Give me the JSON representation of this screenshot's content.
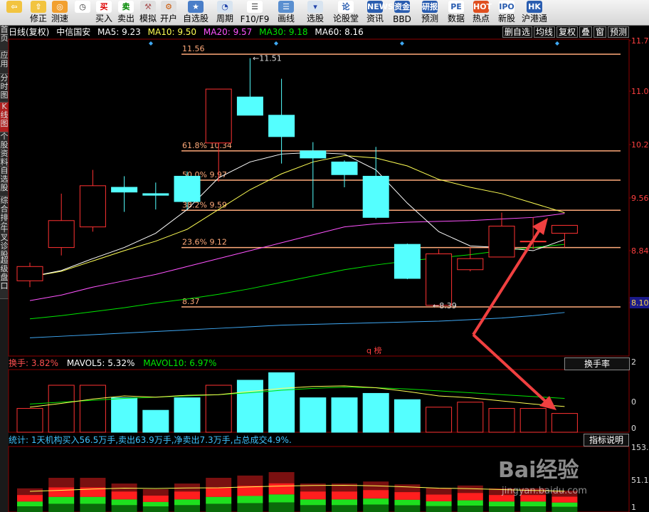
{
  "toolbar": {
    "buttons": [
      {
        "label": "",
        "icon": "back-arrow-icon",
        "glyph": "⇦",
        "bg": "#f2c440",
        "color": "#fff"
      },
      {
        "label": "修正",
        "icon": "up-down-icon",
        "glyph": "⇧",
        "bg": "#f2c440",
        "color": "#fff"
      },
      {
        "label": "测速",
        "icon": "speed-icon",
        "glyph": "◎",
        "bg": "#f2a030",
        "color": "#fff"
      },
      {
        "label": "",
        "icon": "clock-icon",
        "glyph": "◷",
        "bg": "#ffffff",
        "color": "#333"
      },
      {
        "label": "买入",
        "icon": "buy-icon",
        "glyph": "买",
        "bg": "#ffffff",
        "color": "#d00"
      },
      {
        "label": "卖出",
        "icon": "sell-icon",
        "glyph": "卖",
        "bg": "#ffffff",
        "color": "#080"
      },
      {
        "label": "模拟",
        "icon": "hammer-icon",
        "glyph": "⚒",
        "bg": "#e0e0e0",
        "color": "#a55"
      },
      {
        "label": "开户",
        "icon": "open-account-icon",
        "glyph": "⚙",
        "bg": "#e0e0e0",
        "color": "#c50"
      },
      {
        "label": "自选股",
        "icon": "star-icon",
        "glyph": "★",
        "bg": "#4a7ec8",
        "color": "#fff"
      },
      {
        "label": "周期",
        "icon": "cycle-icon",
        "glyph": "◔",
        "bg": "#d8e4f0",
        "color": "#24a"
      },
      {
        "label": "F10/F9",
        "icon": "f10-icon",
        "glyph": "☰",
        "bg": "#ffffff",
        "color": "#333"
      },
      {
        "label": "画线",
        "icon": "draw-line-icon",
        "glyph": "☰",
        "bg": "#5a8fd0",
        "color": "#fff"
      },
      {
        "label": "选股",
        "icon": "select-stock-icon",
        "glyph": "▾",
        "bg": "#d8e4f0",
        "color": "#24a"
      },
      {
        "label": "论股堂",
        "icon": "forum-icon",
        "glyph": "论",
        "bg": "#ffffff",
        "color": "#2a5db0"
      },
      {
        "label": "资讯",
        "icon": "news-icon",
        "glyph": "NEWS",
        "bg": "#2a5db0",
        "color": "#fff"
      },
      {
        "label": "BBD",
        "icon": "bbd-icon",
        "glyph": "资金",
        "bg": "#2a5db0",
        "color": "#fff"
      },
      {
        "label": "预测",
        "icon": "forecast-icon",
        "glyph": "研报",
        "bg": "#2a5db0",
        "color": "#fff"
      },
      {
        "label": "数据",
        "icon": "pe-icon",
        "glyph": "PE",
        "bg": "#ffffff",
        "color": "#2a5db0"
      },
      {
        "label": "热点",
        "icon": "hot-icon",
        "glyph": "HOT",
        "bg": "#e05020",
        "color": "#fff"
      },
      {
        "label": "新股",
        "icon": "ipo-icon",
        "glyph": "IPO",
        "bg": "#ffffff",
        "color": "#2a5db0"
      },
      {
        "label": "沪港通",
        "icon": "hkex-icon",
        "glyph": "HK",
        "bg": "#2a5db0",
        "color": "#fff"
      }
    ]
  },
  "leftbar": [
    "首页",
    "应用",
    "分时图",
    "K线图",
    "个股资料",
    "自选股",
    "综合排名",
    "牛叉诊股",
    "超级盘口"
  ],
  "header": {
    "chart_type": "日线(复权)",
    "stock": "中信国安",
    "ma5": "MA5: 9.23",
    "ma10": "MA10: 9.50",
    "ma20": "MA20: 9.57",
    "ma30": "MA30: 9.18",
    "ma60": "MA60: 8.16",
    "buttons": [
      "删自选",
      "均线",
      "复权",
      "叠",
      "窗",
      "预测"
    ]
  },
  "colors": {
    "up": "#ff3232",
    "down": "#54ffff",
    "ma5": "#ffffff",
    "ma10": "#ffff54",
    "ma20": "#ff54ff",
    "ma30": "#00e600",
    "ma60": "#3fa9f5",
    "fib": "#ffaa7a",
    "arrow": "#f04040"
  },
  "chart_data": {
    "type": "candlestick",
    "ylim": [
      7.75,
      11.75
    ],
    "y_ticks": [
      "11.7",
      "11.0",
      "10.2",
      "9.56",
      "8.84",
      "8.10"
    ],
    "current_price": "8.10",
    "candles": [
      {
        "o": 8.7,
        "c": 8.88,
        "h": 8.93,
        "l": 8.62
      },
      {
        "o": 9.12,
        "c": 9.46,
        "h": 9.8,
        "l": 9.02
      },
      {
        "o": 9.38,
        "c": 9.9,
        "h": 10.1,
        "l": 9.32
      },
      {
        "o": 9.88,
        "c": 9.82,
        "h": 10.02,
        "l": 9.57
      },
      {
        "o": 9.8,
        "c": 9.78,
        "h": 9.94,
        "l": 9.6
      },
      {
        "o": 10.02,
        "c": 9.7,
        "h": 10.08,
        "l": 9.6
      },
      {
        "o": 10.44,
        "c": 11.12,
        "h": 11.12,
        "l": 9.95
      },
      {
        "o": 11.02,
        "c": 10.79,
        "h": 11.51,
        "l": 10.79
      },
      {
        "o": 10.79,
        "c": 10.52,
        "h": 11.25,
        "l": 10.18
      },
      {
        "o": 10.34,
        "c": 10.25,
        "h": 10.45,
        "l": 9.62
      },
      {
        "o": 10.2,
        "c": 10.04,
        "h": 10.22,
        "l": 9.88
      },
      {
        "o": 10.02,
        "c": 9.5,
        "h": 10.39,
        "l": 9.48
      },
      {
        "o": 9.16,
        "c": 8.73,
        "h": 9.17,
        "l": 8.72
      },
      {
        "o": 8.39,
        "c": 9.04,
        "h": 9.1,
        "l": 8.39
      },
      {
        "o": 8.84,
        "c": 8.98,
        "h": 9.12,
        "l": 8.82
      },
      {
        "o": 9.0,
        "c": 9.39,
        "h": 9.56,
        "l": 9.0
      },
      {
        "o": 9.2,
        "c": 9.2,
        "h": 9.5,
        "l": 9.1
      },
      {
        "o": 9.3,
        "c": 9.4,
        "h": 9.4,
        "l": 9.12
      }
    ],
    "ma5": [
      8.75,
      8.83,
      8.98,
      9.12,
      9.3,
      9.6,
      10.0,
      10.2,
      10.3,
      10.32,
      10.3,
      10.1,
      9.68,
      9.32,
      9.14,
      9.12,
      9.08,
      9.22
    ],
    "ma10": [
      8.75,
      8.82,
      8.95,
      9.08,
      9.2,
      9.35,
      9.6,
      9.85,
      10.05,
      10.2,
      10.28,
      10.25,
      10.15,
      9.98,
      9.88,
      9.8,
      9.68,
      9.56
    ],
    "ma20": [
      8.45,
      8.52,
      8.62,
      8.7,
      8.78,
      8.88,
      8.98,
      9.08,
      9.18,
      9.28,
      9.38,
      9.42,
      9.44,
      9.45,
      9.46,
      9.48,
      9.5,
      9.55
    ],
    "ma30": [
      8.22,
      8.26,
      8.31,
      8.36,
      8.42,
      8.47,
      8.53,
      8.6,
      8.68,
      8.76,
      8.84,
      8.9,
      8.95,
      8.99,
      9.03,
      9.08,
      9.12,
      9.16
    ],
    "ma60": [
      7.98,
      8.0,
      8.02,
      8.04,
      8.06,
      8.08,
      8.1,
      8.12,
      8.14,
      8.15,
      8.16,
      8.17,
      8.18,
      8.19,
      8.21,
      8.23,
      8.26,
      8.3
    ],
    "hi_label": "11.51",
    "lo_label": "8.39",
    "fib_levels": [
      {
        "label": "11.56",
        "value": 11.56
      },
      {
        "label": "61.8%  10.34",
        "value": 10.34
      },
      {
        "label": "50.0%  9.97",
        "value": 9.97
      },
      {
        "label": "38.2%  9.59",
        "value": 9.59
      },
      {
        "label": "23.6%  9.12",
        "value": 9.12
      },
      {
        "label": "8.37",
        "value": 8.37
      }
    ],
    "markers": "q  榜",
    "volume": {
      "label_turnover": "换手: 3.82%",
      "label_mavol5": "MAVOL5: 5.32%",
      "label_mavol10": "MAVOL10: 6.97%",
      "selector": "换手率",
      "y_ticks": [
        "2",
        "0",
        "0"
      ],
      "values": [
        3.8,
        7.5,
        7.5,
        5.5,
        3.5,
        5.5,
        7.5,
        8.3,
        9.5,
        5.5,
        5.5,
        6.2,
        5.2,
        4.0,
        4.8,
        3.8,
        3.8,
        3.0
      ],
      "mavol5": [
        4.0,
        4.6,
        5.3,
        5.8,
        5.6,
        5.9,
        6.0,
        6.5,
        7.0,
        7.3,
        7.4,
        7.1,
        6.5,
        5.8,
        5.5,
        5.0,
        4.5,
        4.1
      ],
      "mavol10": [
        4.5,
        4.8,
        5.1,
        5.4,
        5.6,
        5.8,
        6.0,
        6.3,
        6.7,
        7.0,
        7.2,
        7.1,
        6.9,
        6.6,
        6.3,
        6.0,
        5.7,
        5.4
      ]
    },
    "stats": {
      "text": "统计: 1天机构买入56.5万手,卖出63.9万手,净卖出7.3万手,占总成交4.9%.",
      "button": "指标说明",
      "y_ticks": [
        "153.",
        "51.1",
        "1"
      ]
    }
  }
}
